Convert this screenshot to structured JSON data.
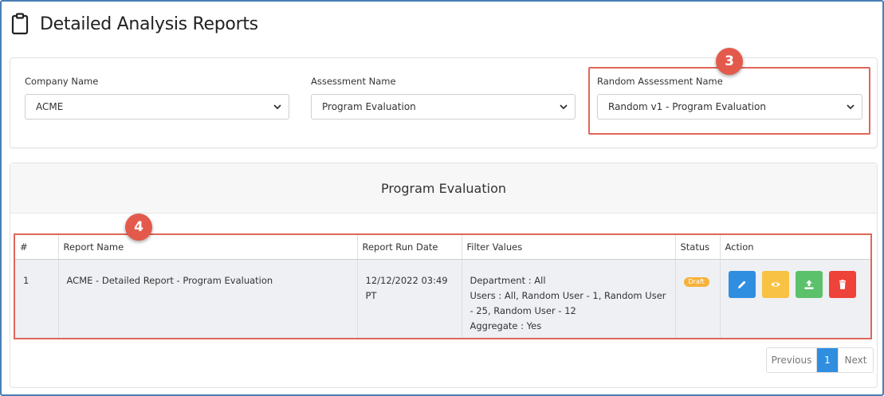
{
  "header": {
    "title": "Detailed Analysis Reports",
    "icon": "clipboard-icon"
  },
  "filters": {
    "company": {
      "label": "Company Name",
      "value": "ACME"
    },
    "assessment": {
      "label": "Assessment Name",
      "value": "Program Evaluation"
    },
    "random_assessment": {
      "label": "Random Assessment Name",
      "value": "Random v1 - Program Evaluation"
    }
  },
  "annotations": {
    "step3": "3",
    "step4": "4"
  },
  "report": {
    "title": "Program Evaluation",
    "columns": [
      "#",
      "Report Name",
      "Report Run Date",
      "Filter Values",
      "Status",
      "Action"
    ],
    "rows": [
      {
        "num": "1",
        "name": "ACME - Detailed Report - Program Evaluation",
        "run_date": "12/12/2022 03:49 PT",
        "filter_department": "Department : All",
        "filter_users": "Users : All, Random User - 1, Random User - 25, Random User - 12",
        "filter_aggregate": "Aggregate : Yes",
        "status": "Draft",
        "actions": [
          "edit-icon",
          "eye-icon",
          "upload-icon",
          "trash-icon"
        ]
      }
    ]
  },
  "pagination": {
    "previous": "Previous",
    "current": "1",
    "next": "Next"
  },
  "colors": {
    "highlight": "#e0665a",
    "primary": "#2f8ee0",
    "warning": "#f8c244",
    "success": "#5cc16b",
    "danger": "#ee4338"
  }
}
